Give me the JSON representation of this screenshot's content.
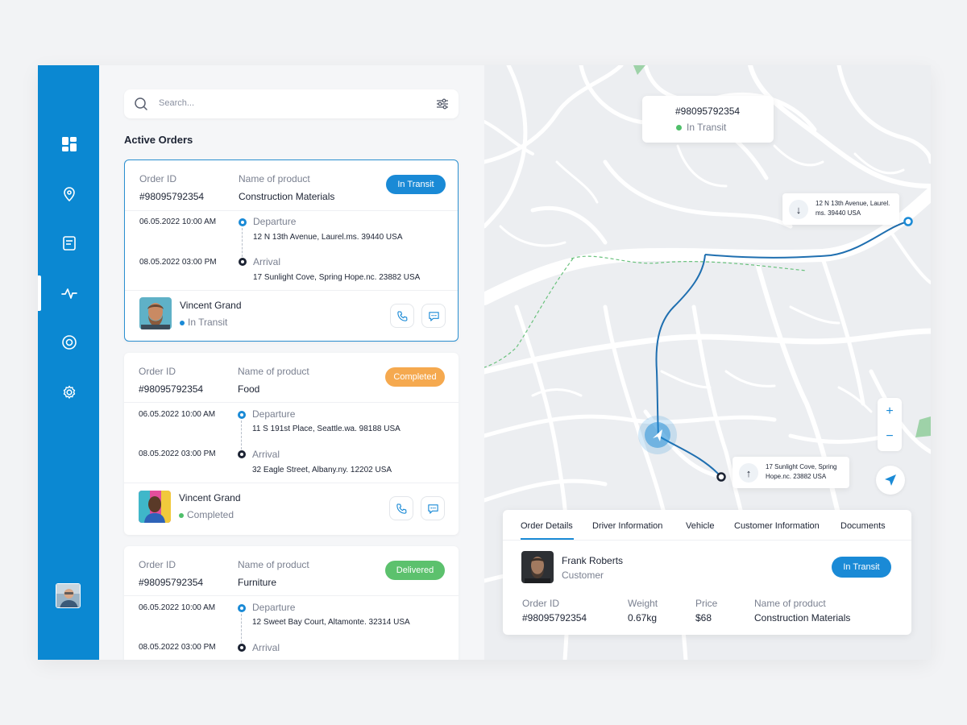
{
  "search": {
    "placeholder": "Search..."
  },
  "active_orders_title": "Active Orders",
  "orders": [
    {
      "order_id_label": "Order ID",
      "order_id": "#98095792354",
      "product_label": "Name of product",
      "product": "Construction Materials",
      "status": "In Transit",
      "status_color": "#1a8ad6",
      "departure_datetime": "06.05.2022   10:00 AM",
      "departure_label": "Departure",
      "departure_address": "12 N 13th Avenue, Laurel.ms. 39440  USA",
      "arrival_datetime": "08.05.2022   03:00 PM",
      "arrival_label": "Arrival",
      "arrival_address": "17 Sunlight Cove, Spring Hope.nc. 23882  USA",
      "driver_name": "Vincent Grand",
      "driver_status": "In Transit",
      "driver_status_color": "#1a8ad6"
    },
    {
      "order_id_label": "Order ID",
      "order_id": "#98095792354",
      "product_label": "Name of product",
      "product": "Food",
      "status": "Completed",
      "status_color": "#f5a94f",
      "departure_datetime": "06.05.2022   10:00 AM",
      "departure_label": "Departure",
      "departure_address": "11 S 191st Place, Seattle.wa. 98188  USA",
      "arrival_datetime": "08.05.2022   03:00 PM",
      "arrival_label": "Arrival",
      "arrival_address": "32 Eagle Street, Albany.ny. 12202  USA",
      "driver_name": "Vincent Grand",
      "driver_status": "Completed",
      "driver_status_color": "#4fbf6a"
    },
    {
      "order_id_label": "Order ID",
      "order_id": "#98095792354",
      "product_label": "Name of product",
      "product": "Furniture",
      "status": "Delivered",
      "status_color": "#5cc16d",
      "departure_datetime": "06.05.2022   10:00 AM",
      "departure_label": "Departure",
      "departure_address": "12 Sweet Bay Court, Altamonte. 32314  USA",
      "arrival_datetime": "08.05.2022   03:00 PM",
      "arrival_label": "Arrival"
    }
  ],
  "map": {
    "chip_order_id": "#98095792354",
    "chip_status": "In Transit",
    "origin_address": "12 N 13th Avenue, Laurel. ms. 39440  USA",
    "dest_address": "17 Sunlight Cove, Spring Hope.nc. 23882  USA",
    "zoom_in": "+",
    "zoom_out": "−"
  },
  "details": {
    "tabs": [
      "Order Details",
      "Driver Information",
      "Vehicle",
      "Customer Information",
      "Documents"
    ],
    "customer_name": "Frank Roberts",
    "customer_role": "Customer",
    "status": "In Transit",
    "order_id_label": "Order ID",
    "order_id": "#98095792354",
    "weight_label": "Weight",
    "weight": "0.67kg",
    "price_label": "Price",
    "price": "$68",
    "product_label": "Name of product",
    "product": "Construction Materials"
  },
  "colors": {
    "sidebar": "#0b88d2",
    "accent": "#1a8ad6",
    "completed": "#f5a94f",
    "delivered": "#5cc16d"
  }
}
